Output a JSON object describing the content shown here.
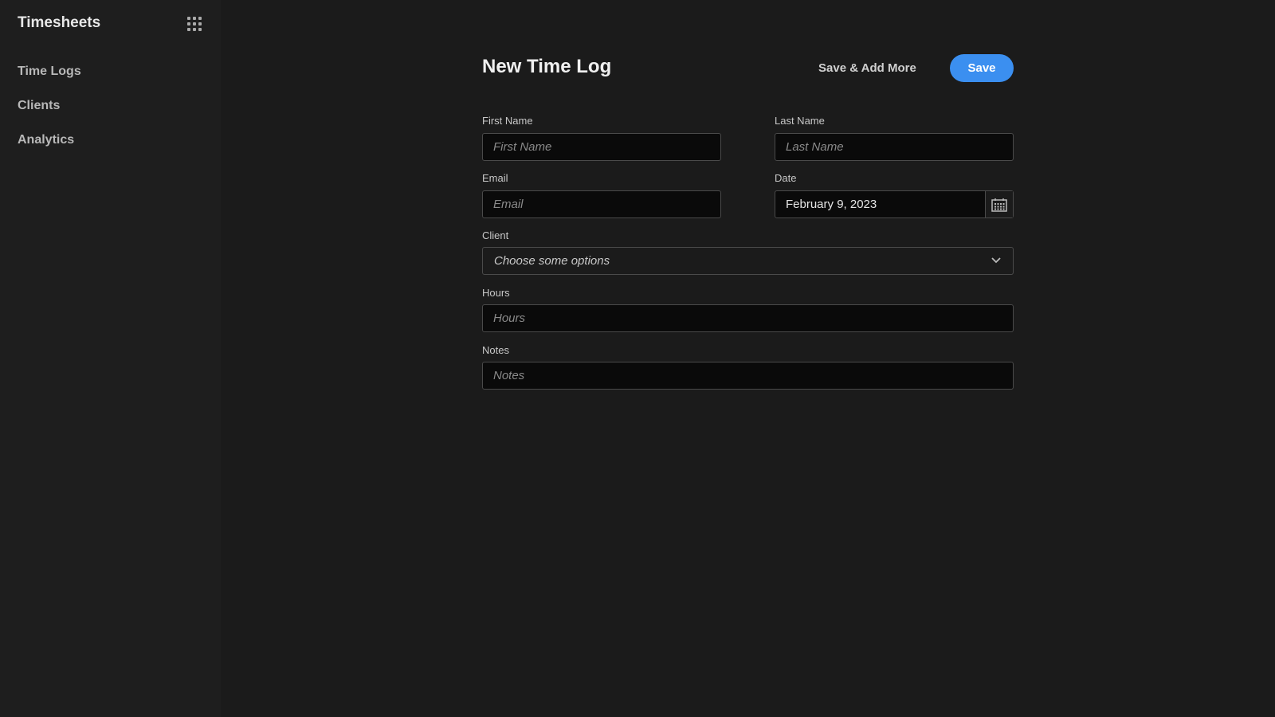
{
  "sidebar": {
    "app_title": "Timesheets",
    "apps_icon": "grid-icon",
    "items": [
      {
        "label": "Time Logs"
      },
      {
        "label": "Clients"
      },
      {
        "label": "Analytics"
      }
    ]
  },
  "header": {
    "title": "New Time Log",
    "save_add_more_label": "Save & Add More",
    "save_label": "Save"
  },
  "form": {
    "first_name": {
      "label": "First Name",
      "placeholder": "First Name",
      "value": ""
    },
    "last_name": {
      "label": "Last Name",
      "placeholder": "Last Name",
      "value": ""
    },
    "email": {
      "label": "Email",
      "placeholder": "Email",
      "value": ""
    },
    "date": {
      "label": "Date",
      "value": "February 9, 2023",
      "icon": "calendar-icon"
    },
    "client": {
      "label": "Client",
      "placeholder": "Choose some options",
      "icon": "chevron-down-icon"
    },
    "hours": {
      "label": "Hours",
      "placeholder": "Hours",
      "value": ""
    },
    "notes": {
      "label": "Notes",
      "placeholder": "Notes",
      "value": ""
    }
  },
  "colors": {
    "accent": "#3b8ff0",
    "background": "#1b1b1b",
    "sidebar": "#1e1e1e"
  }
}
